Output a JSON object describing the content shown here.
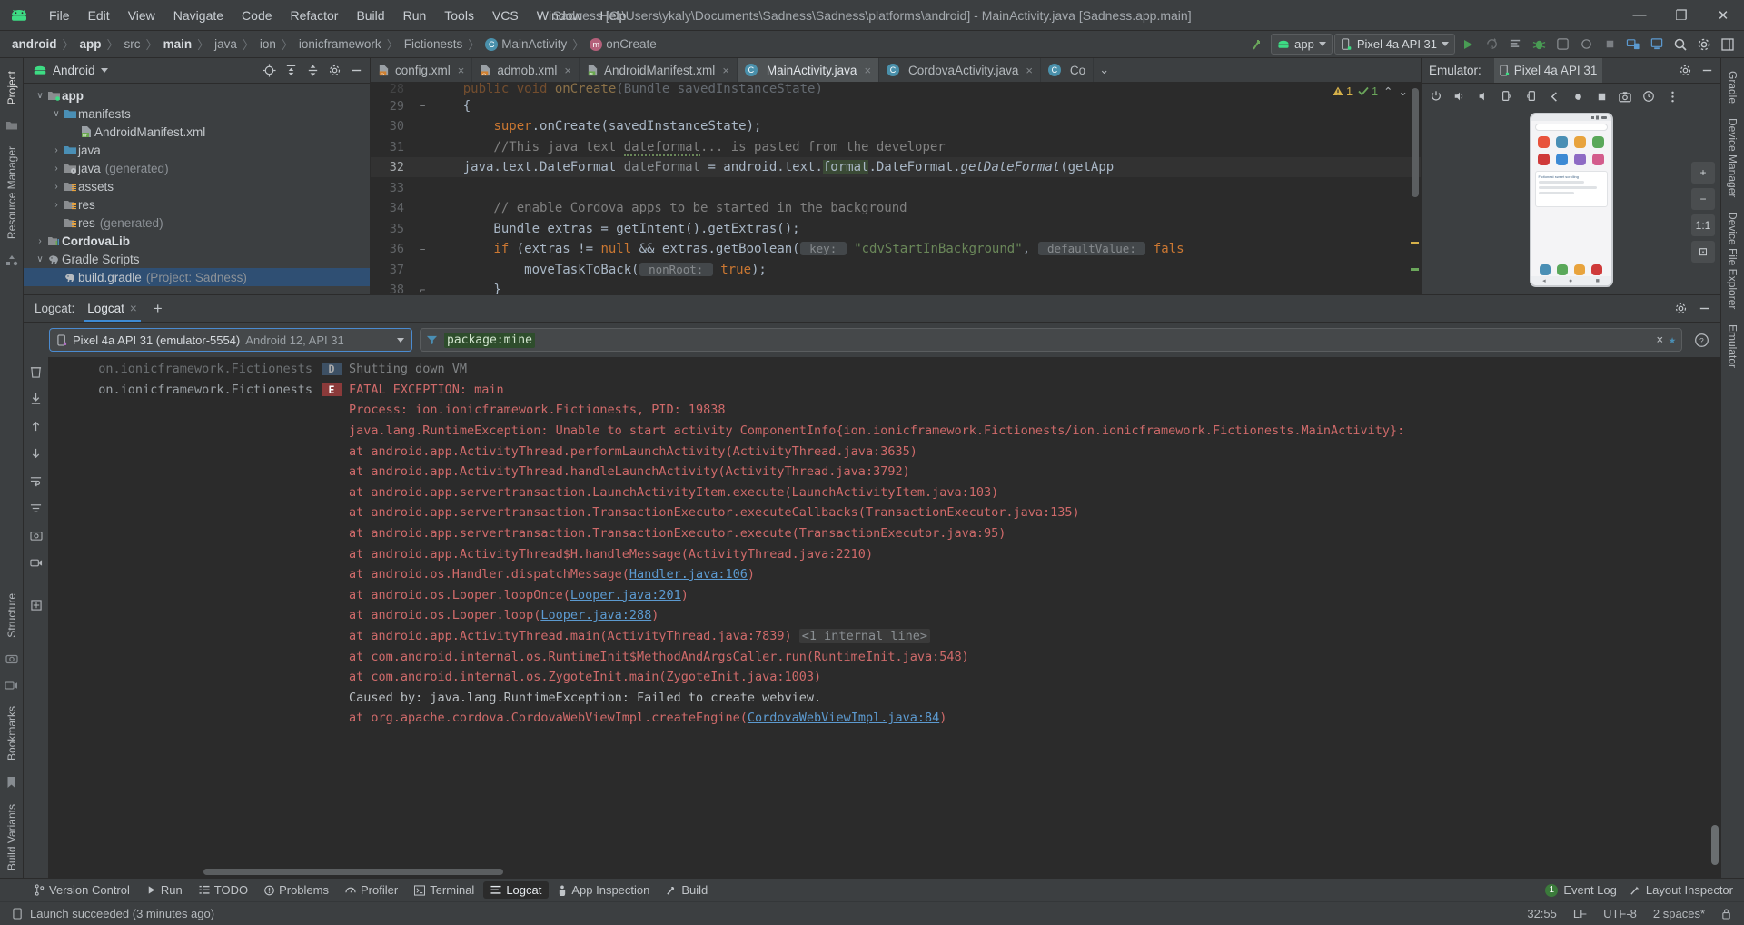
{
  "titlebar": {
    "logo_icon": "android-logo-icon",
    "menu": [
      "File",
      "Edit",
      "View",
      "Navigate",
      "Code",
      "Refactor",
      "Build",
      "Run",
      "Tools",
      "VCS",
      "Window",
      "Help"
    ],
    "window_title": "Sadness [C:\\Users\\ykaly\\Documents\\Sadness\\Sadness\\platforms\\android] - MainActivity.java [Sadness.app.main]",
    "minimize": "—",
    "maximize": "❐",
    "close": "✕"
  },
  "navbar": {
    "breadcrumbs": [
      {
        "label": "android",
        "bold": true,
        "icon": ""
      },
      {
        "label": "app",
        "bold": true,
        "icon": ""
      },
      {
        "label": "src",
        "bold": false,
        "icon": ""
      },
      {
        "label": "main",
        "bold": true,
        "icon": ""
      },
      {
        "label": "java",
        "bold": false,
        "icon": ""
      },
      {
        "label": "ion",
        "bold": false,
        "icon": ""
      },
      {
        "label": "ionicframework",
        "bold": false,
        "icon": ""
      },
      {
        "label": "Fictionests",
        "bold": false,
        "icon": ""
      },
      {
        "label": "MainActivity",
        "bold": false,
        "icon": "class-icon"
      },
      {
        "label": "onCreate",
        "bold": false,
        "icon": "method-icon"
      }
    ],
    "separator": "〉",
    "module_selector": "app",
    "device_selector": "Pixel 4a API 31",
    "actions": [
      "make-project-icon",
      "run-button",
      "apply-changes-icon",
      "apply-code-changes-icon",
      "debug-button",
      "profile-icon",
      "attach-debugger-icon",
      "stop-button",
      "device-manager-icon",
      "avd-manager-icon",
      "search-icon",
      "settings-icon",
      "layout-icon"
    ]
  },
  "left_strip": {
    "items": [
      "Project",
      "Resource Manager"
    ],
    "icons": [
      "folder-icon",
      "structure-icon"
    ]
  },
  "project_panel": {
    "title": "Android",
    "title_icon": "android-head-icon",
    "actions": [
      "locate-file-icon",
      "expand-all-icon",
      "collapse-all-icon",
      "settings-icon",
      "hide-icon"
    ],
    "tree": [
      {
        "indent": 0,
        "arrow": "∨",
        "icon": "module-folder-icon",
        "label": "app",
        "bold": true,
        "dim": "",
        "selected": false
      },
      {
        "indent": 1,
        "arrow": "∨",
        "icon": "folder-blue-icon",
        "label": "manifests",
        "bold": false,
        "dim": "",
        "selected": false
      },
      {
        "indent": 2,
        "arrow": "",
        "icon": "manifest-file-icon",
        "label": "AndroidManifest.xml",
        "bold": false,
        "dim": "",
        "selected": false
      },
      {
        "indent": 1,
        "arrow": "›",
        "icon": "folder-blue-icon",
        "label": "java",
        "bold": false,
        "dim": "",
        "selected": false
      },
      {
        "indent": 1,
        "arrow": "›",
        "icon": "folder-generated-icon",
        "label": "java",
        "bold": false,
        "dim": "(generated)",
        "selected": false
      },
      {
        "indent": 1,
        "arrow": "›",
        "icon": "folder-res-icon",
        "label": "assets",
        "bold": false,
        "dim": "",
        "selected": false
      },
      {
        "indent": 1,
        "arrow": "›",
        "icon": "folder-res-icon",
        "label": "res",
        "bold": false,
        "dim": "",
        "selected": false
      },
      {
        "indent": 1,
        "arrow": "",
        "icon": "folder-res-icon",
        "label": "res",
        "bold": false,
        "dim": "(generated)",
        "selected": false
      },
      {
        "indent": 0,
        "arrow": "›",
        "icon": "library-module-icon",
        "label": "CordovaLib",
        "bold": true,
        "dim": "",
        "selected": false
      },
      {
        "indent": 0,
        "arrow": "∨",
        "icon": "gradle-elephant-icon",
        "label": "Gradle Scripts",
        "bold": false,
        "dim": "",
        "selected": false
      },
      {
        "indent": 1,
        "arrow": "",
        "icon": "gradle-elephant-icon",
        "label": "build.gradle",
        "bold": false,
        "dim": "(Project: Sadness)",
        "selected": true
      }
    ]
  },
  "editor": {
    "tabs": [
      {
        "label": "config.xml",
        "icon": "xml-file-icon",
        "active": false
      },
      {
        "label": "admob.xml",
        "icon": "xml-file-icon",
        "active": false
      },
      {
        "label": "AndroidManifest.xml",
        "icon": "manifest-file-icon",
        "active": false
      },
      {
        "label": "MainActivity.java",
        "icon": "java-class-icon",
        "active": true
      },
      {
        "label": "CordovaActivity.java",
        "icon": "java-class-icon",
        "active": false
      },
      {
        "label": "Co",
        "icon": "java-class-icon",
        "active": false
      }
    ],
    "close_glyph": "×",
    "overflow_glyph": "⌄",
    "inspection": {
      "warnings": "1",
      "warn_icon": "warning-triangle-icon",
      "checks": "1",
      "ok_icon": "check-icon",
      "up": "⌃",
      "down": "⌄"
    },
    "lines": [
      {
        "num": "28",
        "fold": "",
        "segments": [
          {
            "t": "    ",
            "c": ""
          },
          {
            "t": "public void",
            "c": "k"
          },
          {
            "t": " onCreate(Bundle savedInstanceState)",
            "c": ""
          }
        ],
        "current": false
      },
      {
        "num": "29",
        "fold": "−",
        "segments": [
          {
            "t": "    {",
            "c": ""
          }
        ],
        "current": false
      },
      {
        "num": "30",
        "fold": "",
        "segments": [
          {
            "t": "        ",
            "c": ""
          },
          {
            "t": "super",
            "c": "k"
          },
          {
            "t": ".onCreate(savedInstanceState);",
            "c": ""
          }
        ],
        "current": false
      },
      {
        "num": "31",
        "fold": "",
        "segments": [
          {
            "t": "        //This java text dateformat... is pasted from the developer",
            "c": "cm"
          }
        ],
        "current": false
      },
      {
        "num": "32",
        "fold": "",
        "segments": [
          {
            "t": "    java.text.DateFormat ",
            "c": ""
          },
          {
            "t": "dateFormat",
            "c": "dim"
          },
          {
            "t": " = android.text.",
            "c": ""
          },
          {
            "t": "format",
            "c": "sel"
          },
          {
            "t": ".DateFormat.",
            "c": ""
          },
          {
            "t": "getDateFormat",
            "c": "it"
          },
          {
            "t": "(getApp",
            "c": ""
          }
        ],
        "current": true
      },
      {
        "num": "33",
        "fold": "",
        "segments": [],
        "current": false
      },
      {
        "num": "34",
        "fold": "",
        "segments": [
          {
            "t": "        // enable Cordova apps to be started in the background",
            "c": "cm"
          }
        ],
        "current": false
      },
      {
        "num": "35",
        "fold": "",
        "segments": [
          {
            "t": "        Bundle extras = getIntent().getExtras();",
            "c": ""
          }
        ],
        "current": false
      },
      {
        "num": "36",
        "fold": "−",
        "segments": [
          {
            "t": "        ",
            "c": ""
          },
          {
            "t": "if",
            "c": "k"
          },
          {
            "t": " (extras != ",
            "c": ""
          },
          {
            "t": "null",
            "c": "k"
          },
          {
            "t": " && extras.getBoolean(",
            "c": ""
          },
          {
            "t": " key: ",
            "c": "hint"
          },
          {
            "t": "\"cdvStartInBackground\"",
            "c": "s"
          },
          {
            "t": ", ",
            "c": ""
          },
          {
            "t": " defaultValue: ",
            "c": "hint"
          },
          {
            "t": "fals",
            "c": "k"
          }
        ],
        "current": false
      },
      {
        "num": "37",
        "fold": "",
        "segments": [
          {
            "t": "            moveTaskToBack(",
            "c": ""
          },
          {
            "t": " nonRoot: ",
            "c": "hint"
          },
          {
            "t": "true",
            "c": "k"
          },
          {
            "t": ");",
            "c": ""
          }
        ],
        "current": false
      },
      {
        "num": "38",
        "fold": "⌐",
        "segments": [
          {
            "t": "        }",
            "c": ""
          }
        ],
        "current": false
      }
    ]
  },
  "emulator": {
    "label": "Emulator:",
    "tab": "Pixel 4a API 31",
    "tab_icon": "device-icon",
    "header_actions": [
      "settings-icon",
      "hide-icon"
    ],
    "toolbar_icons": [
      "power-icon",
      "volume-up-icon",
      "volume-down-icon",
      "rotate-left-icon",
      "rotate-right-icon",
      "back-icon",
      "home-icon",
      "overview-icon",
      "screenshot-icon",
      "history-icon",
      "more-icon"
    ],
    "side_controls": [
      "+",
      "−",
      "1:1",
      "⊡"
    ],
    "device_screen": {
      "search_placeholder": "",
      "card_title": "Fictionest sweet scrolling"
    }
  },
  "logcat": {
    "label": "Logcat:",
    "tab": "Logcat",
    "close_glyph": "×",
    "add_glyph": "+",
    "actions": [
      "settings-icon",
      "hide-icon"
    ],
    "device": {
      "name": "Pixel 4a API 31 (emulator-5554)",
      "detail": "Android 12, API 31",
      "icon": "device-icon"
    },
    "query": {
      "filter_icon": "filter-icon",
      "value": "package:mine",
      "clear_glyph": "×",
      "favorite_glyph": "★",
      "help_glyph": "?"
    },
    "gutter_icons": [
      "clear-all-icon",
      "scroll-to-end-icon",
      "previous-icon",
      "next-icon",
      "soft-wrap-icon",
      "filters-icon",
      "screenshot-icon",
      "record-icon"
    ],
    "rows": [
      {
        "tag": "on.ionicframework.Fictionests",
        "sev": "D",
        "msg": "Shutting down VM",
        "style": "dim",
        "partial": true
      },
      {
        "tag": "on.ionicframework.Fictionests",
        "sev": "E",
        "msg": "FATAL EXCEPTION: main",
        "style": "err"
      },
      {
        "tag": "",
        "sev": "",
        "msg": "Process: ion.ionicframework.Fictionests, PID: 19838",
        "style": "err"
      },
      {
        "tag": "",
        "sev": "",
        "msg": "java.lang.RuntimeException: Unable to start activity ComponentInfo{ion.ionicframework.Fictionests/ion.ionicframework.Fictionests.MainActivity}:",
        "style": "err"
      },
      {
        "tag": "",
        "sev": "",
        "msg": "    at android.app.ActivityThread.performLaunchActivity(ActivityThread.java:3635)",
        "style": "err"
      },
      {
        "tag": "",
        "sev": "",
        "msg": "    at android.app.ActivityThread.handleLaunchActivity(ActivityThread.java:3792)",
        "style": "err"
      },
      {
        "tag": "",
        "sev": "",
        "msg": "    at android.app.servertransaction.LaunchActivityItem.execute(LaunchActivityItem.java:103)",
        "style": "err"
      },
      {
        "tag": "",
        "sev": "",
        "msg": "    at android.app.servertransaction.TransactionExecutor.executeCallbacks(TransactionExecutor.java:135)",
        "style": "err"
      },
      {
        "tag": "",
        "sev": "",
        "msg": "    at android.app.servertransaction.TransactionExecutor.execute(TransactionExecutor.java:95)",
        "style": "err"
      },
      {
        "tag": "",
        "sev": "",
        "msg": "    at android.app.ActivityThread$H.handleMessage(ActivityThread.java:2210)",
        "style": "err"
      },
      {
        "tag": "",
        "sev": "",
        "msg": "    at android.os.Handler.dispatchMessage(Handler.java:106)",
        "style": "err",
        "link": "Handler.java:106"
      },
      {
        "tag": "",
        "sev": "",
        "msg": "    at android.os.Looper.loopOnce(Looper.java:201)",
        "style": "err",
        "link": "Looper.java:201"
      },
      {
        "tag": "",
        "sev": "",
        "msg": "    at android.os.Looper.loop(Looper.java:288)",
        "style": "err",
        "link": "Looper.java:288"
      },
      {
        "tag": "",
        "sev": "",
        "msg": "    at android.app.ActivityThread.main(ActivityThread.java:7839)",
        "style": "err",
        "internal": "<1 internal line>"
      },
      {
        "tag": "",
        "sev": "",
        "msg": "    at com.android.internal.os.RuntimeInit$MethodAndArgsCaller.run(RuntimeInit.java:548)",
        "style": "err"
      },
      {
        "tag": "",
        "sev": "",
        "msg": "    at com.android.internal.os.ZygoteInit.main(ZygoteInit.java:1003)",
        "style": "err"
      },
      {
        "tag": "",
        "sev": "",
        "msg": "Caused by: java.lang.RuntimeException: Failed to create webview.",
        "style": "dim"
      },
      {
        "tag": "",
        "sev": "",
        "msg": "    at org.apache.cordova.CordovaWebViewImpl.createEngine(CordovaWebViewImpl.java:84)",
        "style": "err",
        "link": "CordovaWebViewImpl.java:84"
      }
    ]
  },
  "toolwindow_bar": {
    "items": [
      {
        "label": "Version Control",
        "icon": "branch-icon",
        "active": false
      },
      {
        "label": "Run",
        "icon": "run-icon",
        "active": false
      },
      {
        "label": "TODO",
        "icon": "todo-icon",
        "active": false
      },
      {
        "label": "Problems",
        "icon": "problems-icon",
        "active": false
      },
      {
        "label": "Profiler",
        "icon": "profiler-icon",
        "active": false
      },
      {
        "label": "Terminal",
        "icon": "terminal-icon",
        "active": false
      },
      {
        "label": "Logcat",
        "icon": "logcat-icon",
        "active": true
      },
      {
        "label": "App Inspection",
        "icon": "app-inspection-icon",
        "active": false
      },
      {
        "label": "Build",
        "icon": "build-icon",
        "active": false
      }
    ],
    "right": [
      {
        "label": "Event Log",
        "icon": "event-log-icon",
        "badge": "1"
      },
      {
        "label": "Layout Inspector",
        "icon": "layout-inspector-icon",
        "badge": ""
      }
    ]
  },
  "statusbar": {
    "icon": "device-icon",
    "message": "Launch succeeded (3 minutes ago)",
    "caret_position": "32:55",
    "line_separator": "LF",
    "encoding": "UTF-8",
    "indent": "2 spaces*",
    "lock_icon": "lock-icon"
  },
  "right_strip": {
    "items": [
      "Gradle",
      "Device Manager",
      "Device File Explorer",
      "Emulator"
    ],
    "left_items": [
      "Structure",
      "Bookmarks",
      "Build Variants"
    ]
  },
  "colors": {
    "accent_blue": "#3d8ad4",
    "error_red": "#cf6a6a",
    "green": "#499c54",
    "panel_bg": "#3c3f41",
    "editor_bg": "#2b2b2b",
    "selection_blue": "#2f4f73"
  }
}
